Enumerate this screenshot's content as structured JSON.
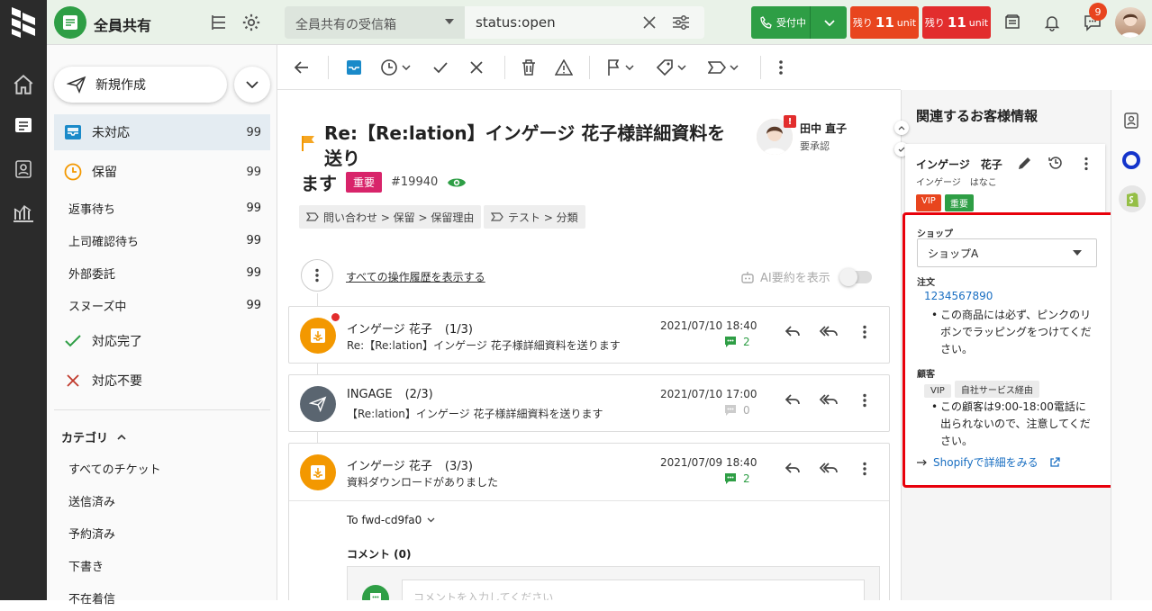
{
  "topbar": {
    "inbox_title": "全員共有",
    "inbox_select": "全員共有の受信箱",
    "search_query": "status:open",
    "status_button": "受付中",
    "remain1_prefix": "残り",
    "remain1_count": "11",
    "remain1_unit": "unit",
    "remain2_prefix": "残り",
    "remain2_count": "11",
    "remain2_unit": "unit",
    "chat_badge": "9"
  },
  "sidebar": {
    "compose_label": "新規作成",
    "items": [
      {
        "label": "未対応",
        "count": "99"
      },
      {
        "label": "保留",
        "count": "99"
      }
    ],
    "sub_items": [
      {
        "label": "返事待ち",
        "count": "99"
      },
      {
        "label": "上司確認待ち",
        "count": "99"
      },
      {
        "label": "外部委託",
        "count": "99"
      },
      {
        "label": "スヌーズ中",
        "count": "99"
      }
    ],
    "done_label": "対応完了",
    "unneeded_label": "対応不要",
    "category_header": "カテゴリ",
    "categories": [
      "すべてのチケット",
      "送信済み",
      "予約済み",
      "下書き",
      "不在着信"
    ]
  },
  "ticket": {
    "subject_line1": "Re:【Re:lation】インゲージ 花子様詳細資料を送り",
    "subject_line2": "ます",
    "tag": "重要",
    "number": "#19940",
    "assignee_name": "田中 直子",
    "assignee_status": "要承認",
    "chips": [
      "問い合わせ > 保留 > 保留理由",
      "テスト > 分類"
    ],
    "history_link": "すべての操作履歴を表示する",
    "ai_summary": "AI要約を表示"
  },
  "messages": [
    {
      "from": "インゲージ 花子",
      "index": "(1/3)",
      "subject": "Re:【Re:lation】インゲージ 花子様詳細資料を送ります",
      "date": "2021/07/10 18:40",
      "comments": "2"
    },
    {
      "from": "INGAGE",
      "index": "(2/3)",
      "subject": "【Re:lation】インゲージ 花子様詳細資料を送ります",
      "date": "2021/07/10 17:00",
      "comments": "0"
    },
    {
      "from": "インゲージ 花子",
      "index": "(3/3)",
      "subject": "資料ダウンロードがありました",
      "date": "2021/07/09 18:40",
      "comments": "2"
    }
  ],
  "expanded": {
    "to": "To fwd-cd9fa0",
    "comment_header": "コメント (0)",
    "comment_placeholder": "コメントを入力してください"
  },
  "customer": {
    "panel_title": "関連するお客様情報",
    "name": "インゲージ　花子",
    "kana": "インゲージ　はなこ",
    "tags": [
      "VIP",
      "重要"
    ],
    "shop_label": "ショップ",
    "shop_value": "ショップA",
    "order_label": "注文",
    "order_number": "1234567890",
    "order_note": "この商品には必ず、ピンクのリボンでラッピングをつけてください。",
    "customer_label": "顧客",
    "customer_tags": [
      "VIP",
      "自社サービス経由"
    ],
    "customer_note": "この顧客は9:00-18:00電話に出られないので、注意してください。",
    "shopify_link": "Shopifyで詳細をみる"
  },
  "colors": {
    "brand_green": "#2e9e45",
    "alert_red": "#e8451e",
    "tag_pink": "#d8246a",
    "link_blue": "#1a6fc2",
    "highlight_red": "#e8000b"
  }
}
